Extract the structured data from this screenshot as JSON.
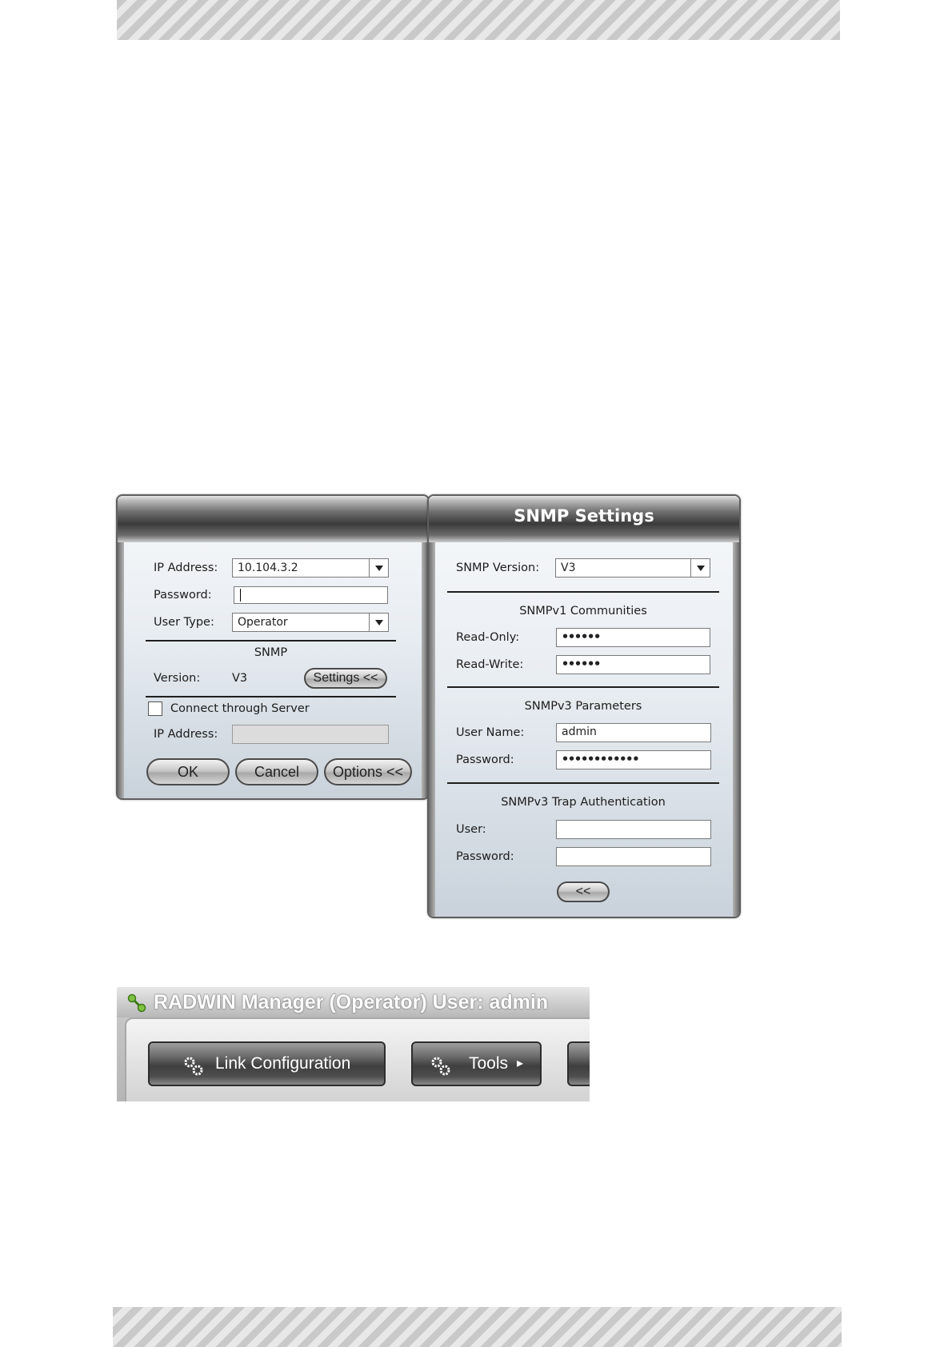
{
  "login_dialog": {
    "title": "",
    "ip_label": "IP Address:",
    "ip_value": "10.104.3.2",
    "password_label": "Password:",
    "password_value": "",
    "user_type_label": "User Type:",
    "user_type_value": "Operator",
    "snmp_heading": "SNMP",
    "version_label": "Version:",
    "version_value": "V3",
    "settings_button": "Settings <<",
    "connect_server_label": "Connect through Server",
    "connect_server_checked": false,
    "server_ip_label": "IP Address:",
    "server_ip_value": "",
    "ok_button": "OK",
    "cancel_button": "Cancel",
    "options_button": "Options <<"
  },
  "snmp_dialog": {
    "title": "SNMP Settings",
    "version_label": "SNMP Version:",
    "version_value": "V3",
    "v1_heading": "SNMPv1 Communities",
    "read_only_label": "Read-Only:",
    "read_only_value": "••••••",
    "read_write_label": "Read-Write:",
    "read_write_value": "••••••",
    "v3_heading": "SNMPv3 Parameters",
    "user_name_label": "User Name:",
    "user_name_value": "admin",
    "v3_password_label": "Password:",
    "v3_password_value": "••••••••••••",
    "trap_heading": "SNMPv3 Trap Authentication",
    "trap_user_label": "User:",
    "trap_user_value": "",
    "trap_password_label": "Password:",
    "trap_password_value": "",
    "collapse_button": "<<"
  },
  "manager_window": {
    "title": "RADWIN Manager (Operator) User: admin",
    "buttons": [
      "Link Configuration",
      "Tools"
    ],
    "tools_arrow": "▸"
  },
  "colors": {
    "header_dark": "#3b3b3b",
    "dialog_body": "#e8edf2",
    "title_text": "#ffffff"
  }
}
